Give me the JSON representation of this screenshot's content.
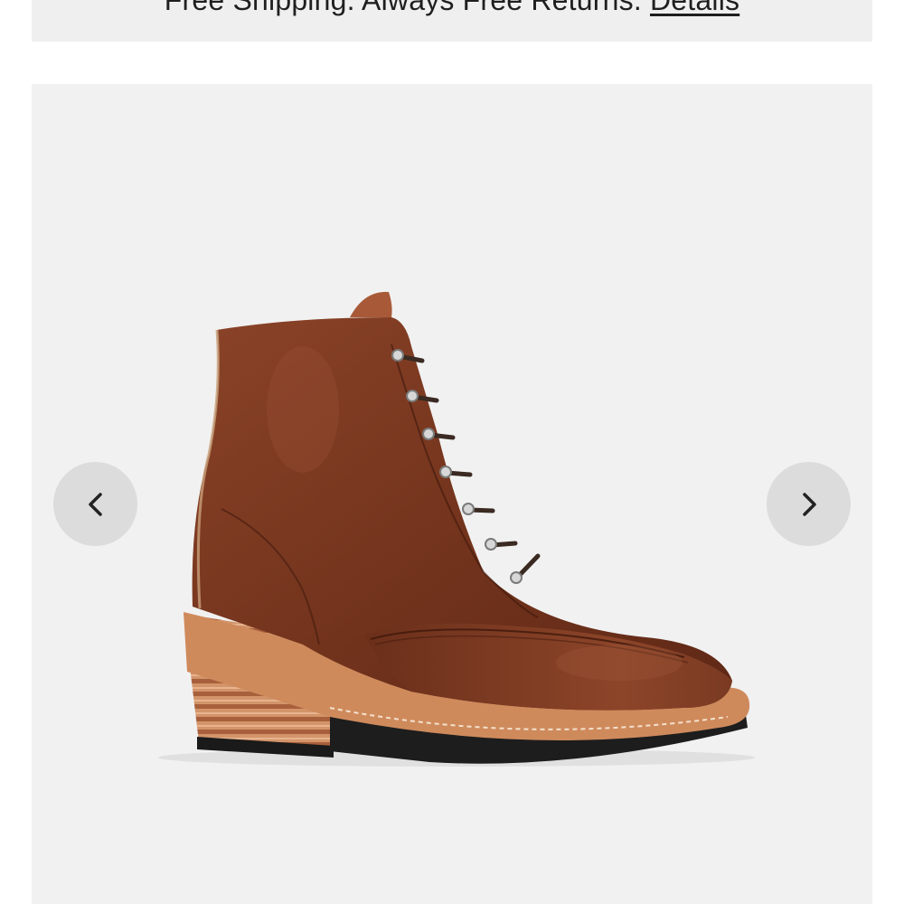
{
  "promo": {
    "text": "Free Shipping. Always Free Returns.",
    "link_label": "Details"
  },
  "gallery": {
    "image_alt": "Brown leather lace-up heeled ankle boot",
    "prev_icon": "chevron-left-icon",
    "next_icon": "chevron-right-icon"
  },
  "colors": {
    "banner_bg": "#efefef",
    "gallery_bg": "#f1f1f1",
    "nav_button_bg": "#dcdcdc",
    "leather": "#7a3a22",
    "heel_wood": "#c9845a"
  }
}
